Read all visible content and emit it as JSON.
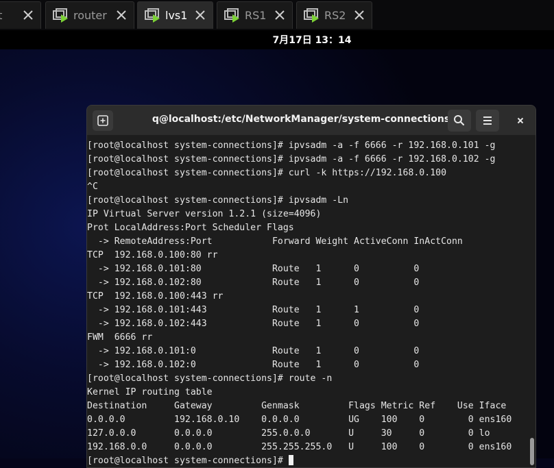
{
  "tabs": [
    {
      "label": "nt",
      "active": false,
      "icon": "vm-icon",
      "truncated": true
    },
    {
      "label": "router",
      "active": false,
      "icon": "vm-icon"
    },
    {
      "label": "lvs1",
      "active": true,
      "icon": "vm-icon"
    },
    {
      "label": "RS1",
      "active": false,
      "icon": "vm-icon"
    },
    {
      "label": "RS2",
      "active": false,
      "icon": "vm-icon"
    }
  ],
  "clock": "7月17日  13：14",
  "terminal": {
    "title": "q@localhost:/etc/NetworkManager/system-connections",
    "lines": [
      "[root@localhost system-connections]# ipvsadm -a -f 6666 -r 192.168.0.101 -g",
      "[root@localhost system-connections]# ipvsadm -a -f 6666 -r 192.168.0.102 -g",
      "[root@localhost system-connections]# curl -k https://192.168.0.100",
      "^C",
      "[root@localhost system-connections]# ipvsadm -Ln",
      "IP Virtual Server version 1.2.1 (size=4096)",
      "Prot LocalAddress:Port Scheduler Flags",
      "  -> RemoteAddress:Port           Forward Weight ActiveConn InActConn",
      "TCP  192.168.0.100:80 rr",
      "  -> 192.168.0.101:80             Route   1      0          0",
      "  -> 192.168.0.102:80             Route   1      0          0",
      "TCP  192.168.0.100:443 rr",
      "  -> 192.168.0.101:443            Route   1      1          0",
      "  -> 192.168.0.102:443            Route   1      0          0",
      "FWM  6666 rr",
      "  -> 192.168.0.101:0              Route   1      0          0",
      "  -> 192.168.0.102:0              Route   1      0          0",
      "[root@localhost system-connections]# route -n",
      "Kernel IP routing table",
      "Destination     Gateway         Genmask         Flags Metric Ref    Use Iface",
      "0.0.0.0         192.168.0.10    0.0.0.0         UG    100    0        0 ens160",
      "127.0.0.0       0.0.0.0         255.0.0.0       U     30     0        0 lo",
      "192.168.0.0     0.0.0.0         255.255.255.0   U     100    0        0 ens160",
      "[root@localhost system-connections]# "
    ]
  },
  "colors": {
    "background": "#05051a",
    "terminal_bg": "#1d1d1d",
    "header_bg": "#2c2c2c",
    "text": "#e6e6e6",
    "vm_icon_accent": "#7bd035"
  }
}
